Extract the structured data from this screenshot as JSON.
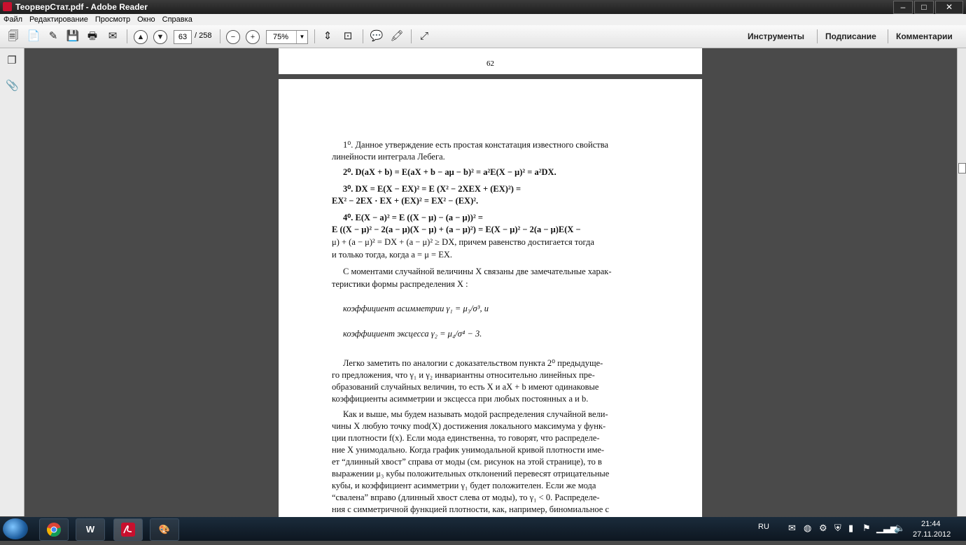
{
  "window": {
    "title": "ТеорверСтат.pdf - Adobe Reader",
    "controls": [
      "–",
      "□",
      "✕"
    ]
  },
  "menu": [
    "Файл",
    "Редактирование",
    "Просмотр",
    "Окно",
    "Справка"
  ],
  "toolbar": {
    "current_page": "63",
    "total_pages": "/ 258",
    "zoom": "75%",
    "links": {
      "tools": "Инструменты",
      "sign": "Подписание",
      "comments": "Комментарии"
    }
  },
  "document": {
    "prev_page_number": "62",
    "lines": [
      "1⁰.  Данное утверждение есть простая констатация известного свойства",
      "линейности интеграла Лебега.",
      "2⁰.  D(aX + b) = E(aX + b − aμ − b)² = a²E(X − μ)² = a²DX.",
      "3⁰.  DX = E(X − EX)² = E (X² − 2XEX + (EX)²) =",
      "EX² − 2EX · EX + (EX)² = EX² − (EX)².",
      "4⁰.  E(X − a)² = E ((X − μ) − (a − μ))² =",
      "E ((X − μ)² − 2(a − μ)(X − μ) + (a − μ)²) = E(X − μ)² − 2(a − μ)E(X −",
      "μ) + (a − μ)² = DX + (a − μ)² ≥ DX, причем равенство достигается тогда",
      "и только тогда, когда a = μ = EX.",
      "С моментами случайной величины X связаны две замечательные харак-",
      "теристики формы распределения X :",
      "коэффициент асимметрии γ₁ = μ₃/σ³, и",
      "коэффициент эксцесса γ₂ = μ₄/σ⁴ − 3.",
      "Легко заметить по аналогии с доказательством пункта 2⁰ предыдуще-",
      "го предложения, что γ₁ и γ₂ инвариантны относительно линейных пре-",
      "образований случайных величин, то есть X и aX + b имеют одинаковые",
      "коэффициенты асимметрии и эксцесса при любых постоянных a и b.",
      "Как и выше, мы будем называть модой распределения случайной вели-",
      "чины X любую точку mod(X) достижения локального максимума у функ-",
      "ции плотности f(x). Если мода единственна, то говорят, что распределе-",
      "ние X унимодально. Когда график унимодальной кривой плотности име-",
      "ет “длинный хвост” справа от моды (см. рисунок на этой странице), то в",
      "выражении μ₃ кубы положительных отклонений перевесят отрицательные",
      "кубы, и коэффициент асимметрии γ₁ будет положителен. Если же мода",
      "“свалена” вправо (длинный хвост слева от моды), то γ₁ < 0. Распределе-",
      "ния с симметричной функцией плотности, как, например, биномиальное с"
    ]
  },
  "taskbar": {
    "apps": [
      "W",
      "🎨"
    ],
    "tray": {
      "lang": "RU",
      "time": "21:44",
      "date": "27.11.2012"
    }
  }
}
